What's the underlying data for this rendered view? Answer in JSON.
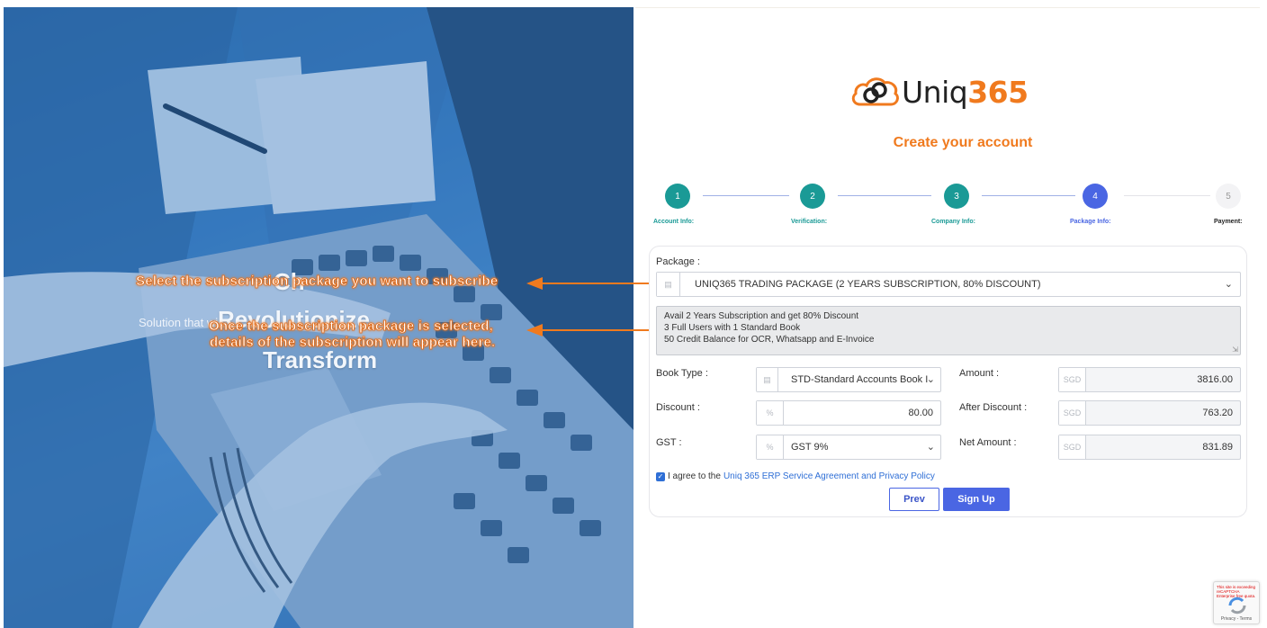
{
  "hero": {
    "heading_partial": "Ch",
    "subtitle": "Solution that wi",
    "revolutionize": "Revolutionize",
    "transform": "Transform"
  },
  "annotations": {
    "package_hint": "Select the subscription package you want to subscribe",
    "details_hint_line1": "Once the subscription package is selected,",
    "details_hint_line2": "details of the subscription will appear here."
  },
  "brand": {
    "name_plain": "Uniq",
    "name_accent": "365",
    "accent_color": "#f07a1e"
  },
  "title": "Create your account",
  "steps": [
    {
      "number": "1",
      "label": "Account Info:",
      "state": "done"
    },
    {
      "number": "2",
      "label": "Verification:",
      "state": "done"
    },
    {
      "number": "3",
      "label": "Company Info:",
      "state": "done"
    },
    {
      "number": "4",
      "label": "Package Info:",
      "state": "active"
    },
    {
      "number": "5",
      "label": "Payment:",
      "state": "pending"
    }
  ],
  "form": {
    "package_label": "Package :",
    "package_value": "UNIQ365 TRADING PACKAGE (2 YEARS SUBSCRIPTION, 80% DISCOUNT)",
    "details": [
      "Avail 2 Years Subscription and get 80% Discount",
      "3 Full Users with 1 Standard Book",
      "50 Credit Balance for OCR, Whatsapp and E-Invoice"
    ],
    "book_type_label": "Book Type :",
    "book_type_value": "STD-Standard Accounts Book I",
    "amount_label": "Amount :",
    "amount_currency": "SGD",
    "amount_value": "3816.00",
    "discount_label": "Discount :",
    "discount_addon": "%",
    "discount_value": "80.00",
    "after_discount_label": "After Discount :",
    "after_discount_currency": "SGD",
    "after_discount_value": "763.20",
    "gst_label": "GST :",
    "gst_addon": "%",
    "gst_value": "GST 9%",
    "net_amount_label": "Net Amount :",
    "net_amount_currency": "SGD",
    "net_amount_value": "831.89",
    "agree_text": "I agree to the",
    "agree_link": "Uniq 365 ERP Service Agreement and Privacy Policy",
    "agree_checked": true
  },
  "buttons": {
    "prev": "Prev",
    "signup": "Sign Up"
  },
  "captcha": {
    "warning": "This site is exceeding reCAPTCHA Enterprise free quota.",
    "terms": "Privacy - Terms"
  }
}
